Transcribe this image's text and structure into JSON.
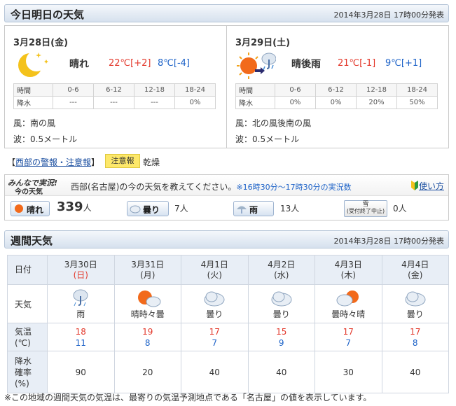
{
  "today_header": {
    "title": "今日明日の天気",
    "issued": "2014年3月28日 17時00分発表"
  },
  "today": {
    "date": "3月28日(金)",
    "weather": "晴れ",
    "high": "22℃[+2]",
    "low": "8℃[-4]",
    "precip_label": "降水",
    "time_label": "時間",
    "periods": [
      "0-6",
      "6-12",
      "12-18",
      "18-24"
    ],
    "precip": [
      "---",
      "---",
      "---",
      "0%"
    ],
    "wind": "風：南の風",
    "wave": "波：0.5メートル",
    "icon": "moon-icon"
  },
  "tomorrow": {
    "date": "3月29日(土)",
    "weather": "晴後雨",
    "high": "21℃[-1]",
    "low": "9℃[+1]",
    "precip_label": "降水",
    "time_label": "時間",
    "periods": [
      "0-6",
      "6-12",
      "12-18",
      "18-24"
    ],
    "precip": [
      "0%",
      "0%",
      "20%",
      "50%"
    ],
    "wind": "風：北の風後南の風",
    "wave": "波：0.5メートル",
    "icon": "sun-then-rain-icon"
  },
  "warnings": {
    "link": "西部の警報・注意報",
    "open": "【",
    "close": "】",
    "badge": "注意報",
    "item": "乾燥"
  },
  "live": {
    "logo_line1": "みんなで実況!",
    "logo_line2": "今の天気",
    "prompt": "西部(名古屋)の今の天気を教えてください。",
    "window": "※16時30分〜17時30分の実況数",
    "howto": "使い方",
    "votes": [
      {
        "label": "晴れ",
        "count": "339",
        "unit": "人"
      },
      {
        "label": "曇り",
        "count": "7人"
      },
      {
        "label": "雨",
        "count": "13人"
      },
      {
        "label_line1": "雪",
        "label_line2": "(受付終了中止)",
        "count": "0人"
      }
    ]
  },
  "weekly_header": {
    "title": "週間天気",
    "issued": "2014年3月28日 17時00分発表"
  },
  "weekly": {
    "row_labels": {
      "date": "日付",
      "weather": "天気",
      "temp_line1": "気温",
      "temp_line2": "(℃)",
      "pop_line1": "降水",
      "pop_line2": "確率",
      "pop_line3": "(%)"
    },
    "days": [
      {
        "date": "3月30日",
        "dow": "(日)",
        "weather": "雨",
        "high": "18",
        "low": "11",
        "pop": "90",
        "icon": "rain-icon"
      },
      {
        "date": "3月31日",
        "dow": "(月)",
        "weather": "晴時々曇",
        "high": "19",
        "low": "8",
        "pop": "20",
        "icon": "sun-cloud-icon"
      },
      {
        "date": "4月1日",
        "dow": "(火)",
        "weather": "曇り",
        "high": "17",
        "low": "7",
        "pop": "40",
        "icon": "cloud-icon"
      },
      {
        "date": "4月2日",
        "dow": "(水)",
        "weather": "曇り",
        "high": "15",
        "low": "9",
        "pop": "40",
        "icon": "cloud-icon"
      },
      {
        "date": "4月3日",
        "dow": "(木)",
        "weather": "曇時々晴",
        "high": "17",
        "low": "7",
        "pop": "30",
        "icon": "cloud-sun-icon"
      },
      {
        "date": "4月4日",
        "dow": "(金)",
        "weather": "曇り",
        "high": "17",
        "low": "8",
        "pop": "40",
        "icon": "cloud-icon"
      }
    ]
  },
  "footnote": "※この地域の週間天気の気温は、最寄りの気温予測地点である「名古屋」の値を表示しています。"
}
